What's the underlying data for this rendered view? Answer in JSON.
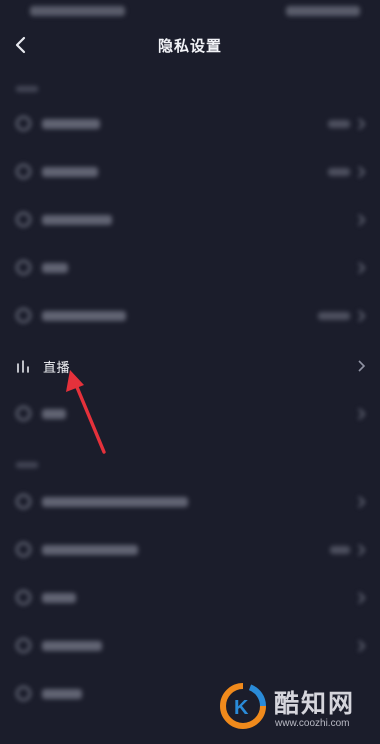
{
  "header": {
    "title": "隐私设置"
  },
  "rows": {
    "live": {
      "label": "直播"
    }
  },
  "watermark": {
    "name": "酷知网",
    "url": "www.coozhi.com"
  },
  "colors": {
    "background": "#1b1d2b",
    "text": "#f1f2f6",
    "arrow": "#e5313b",
    "watermark_orange": "#f08a1c",
    "watermark_blue": "#2a8bd8"
  },
  "icons": {
    "back": "back-arrow-icon",
    "live": "bar-chart-icon",
    "chevron": "chevron-right-icon"
  }
}
